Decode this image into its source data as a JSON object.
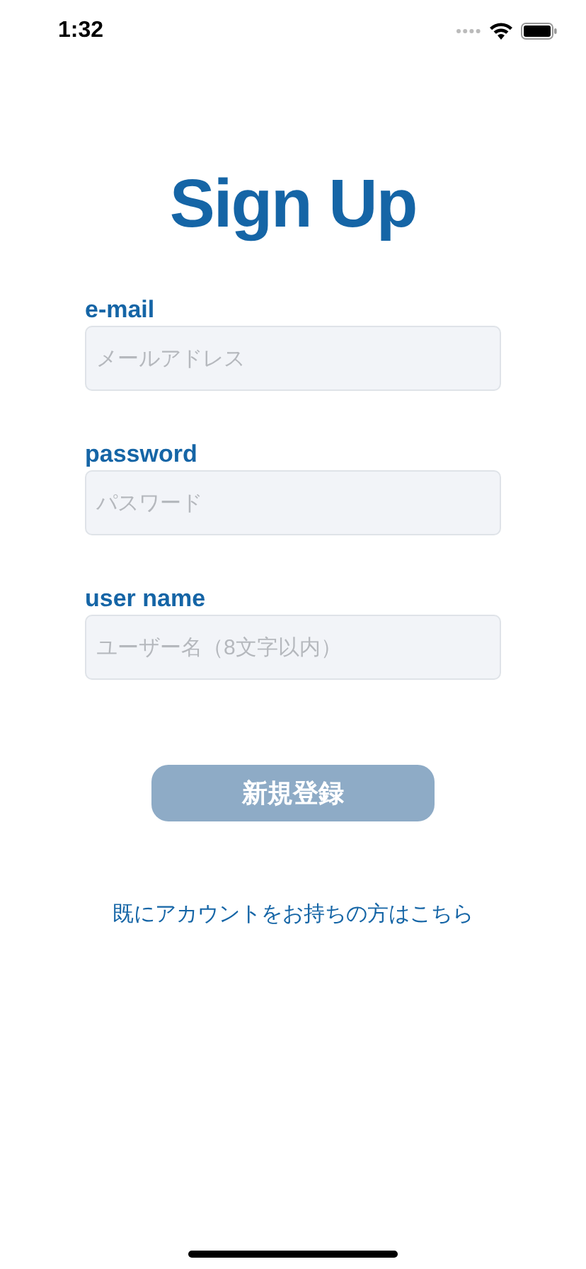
{
  "status_bar": {
    "time": "1:32"
  },
  "title": "Sign Up",
  "fields": [
    {
      "label": "e-mail",
      "placeholder": "メールアドレス"
    },
    {
      "label": "password",
      "placeholder": "パスワード"
    },
    {
      "label": "user name",
      "placeholder": "ユーザー名（8文字以内）"
    }
  ],
  "submit_button": {
    "label": "新規登録",
    "disabled": true
  },
  "login_link": "既にアカウントをお持ちの方はこちら"
}
